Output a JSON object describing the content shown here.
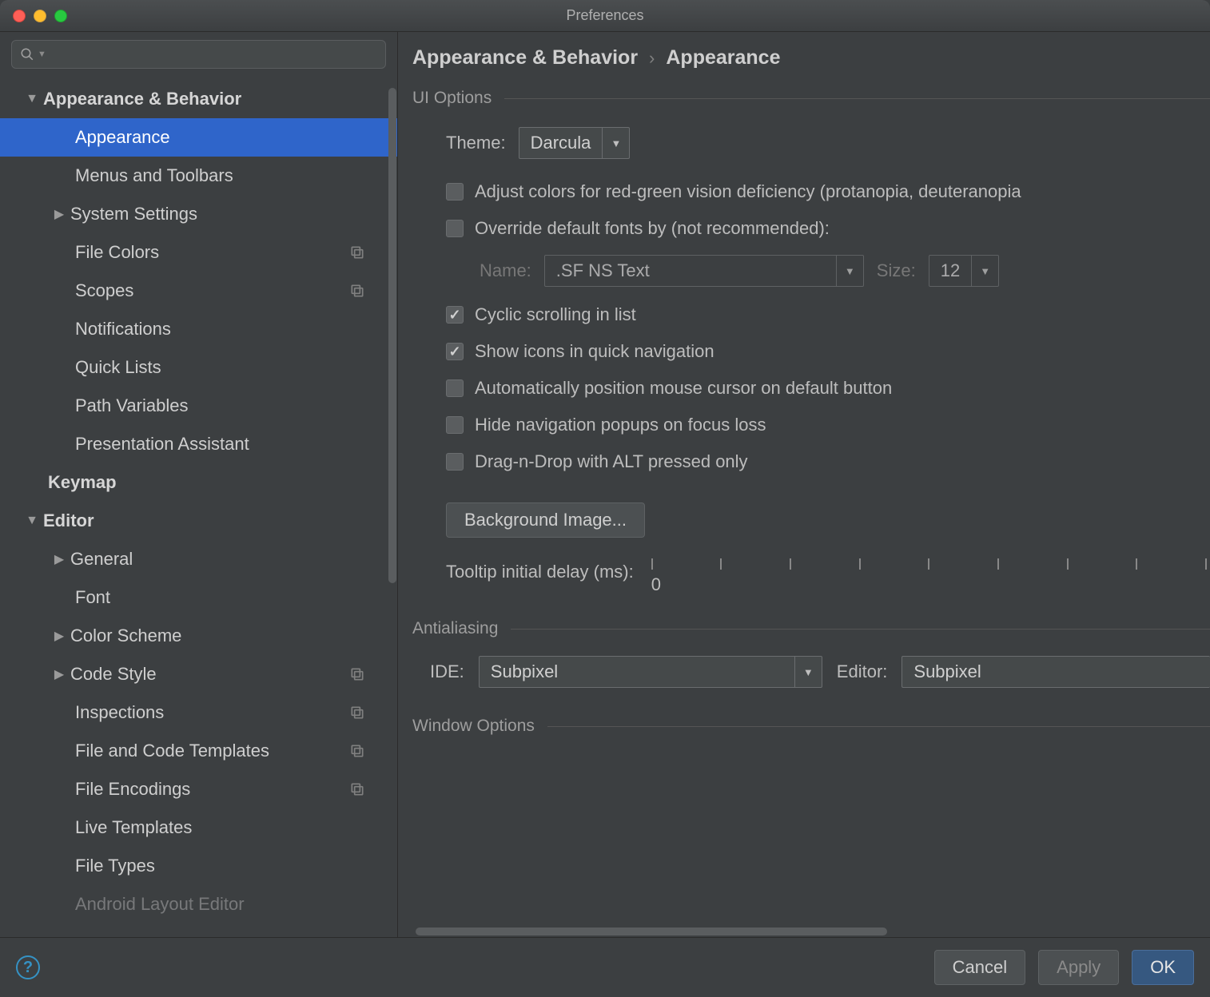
{
  "window": {
    "title": "Preferences"
  },
  "breadcrumb": {
    "root": "Appearance & Behavior",
    "leaf": "Appearance"
  },
  "sections": {
    "ui_options": "UI Options",
    "antialiasing": "Antialiasing",
    "window_options": "Window Options"
  },
  "sidebar": {
    "items": [
      {
        "label": "Appearance & Behavior",
        "level": 0,
        "expanded": true,
        "arrow": true
      },
      {
        "label": "Appearance",
        "level": 1,
        "selected": true
      },
      {
        "label": "Menus and Toolbars",
        "level": 1
      },
      {
        "label": "System Settings",
        "level": 1,
        "arrow": true,
        "expanded": false
      },
      {
        "label": "File Colors",
        "level": 1,
        "copyable": true
      },
      {
        "label": "Scopes",
        "level": 1,
        "copyable": true
      },
      {
        "label": "Notifications",
        "level": 1
      },
      {
        "label": "Quick Lists",
        "level": 1
      },
      {
        "label": "Path Variables",
        "level": 1
      },
      {
        "label": "Presentation Assistant",
        "level": 1
      },
      {
        "label": "Keymap",
        "level": 0,
        "arrow": false,
        "top": true
      },
      {
        "label": "Editor",
        "level": 0,
        "expanded": true,
        "arrow": true
      },
      {
        "label": "General",
        "level": 1,
        "arrow": true,
        "expanded": false
      },
      {
        "label": "Font",
        "level": 1
      },
      {
        "label": "Color Scheme",
        "level": 1,
        "arrow": true,
        "expanded": false
      },
      {
        "label": "Code Style",
        "level": 1,
        "arrow": true,
        "expanded": false,
        "copyable": true
      },
      {
        "label": "Inspections",
        "level": 1,
        "copyable": true
      },
      {
        "label": "File and Code Templates",
        "level": 1,
        "copyable": true
      },
      {
        "label": "File Encodings",
        "level": 1,
        "copyable": true
      },
      {
        "label": "Live Templates",
        "level": 1
      },
      {
        "label": "File Types",
        "level": 1
      },
      {
        "label": "Android Layout Editor",
        "level": 1,
        "partial": true
      }
    ]
  },
  "ui": {
    "theme_label": "Theme:",
    "theme_value": "Darcula",
    "cb_adjust_colors": "Adjust colors for red-green vision deficiency (protanopia, deuteranopia",
    "cb_override_fonts": "Override default fonts by (not recommended):",
    "font_name_label": "Name:",
    "font_name_value": ".SF NS Text",
    "font_size_label": "Size:",
    "font_size_value": "12",
    "cb_cyclic": "Cyclic scrolling in list",
    "cb_show_icons": "Show icons in quick navigation",
    "cb_auto_mouse": "Automatically position mouse cursor on default button",
    "cb_hide_nav": "Hide navigation popups on focus loss",
    "cb_dnd_alt": "Drag-n-Drop with ALT pressed only",
    "bg_image_btn": "Background Image...",
    "tooltip_label": "Tooltip initial delay (ms):",
    "tooltip_value": "0"
  },
  "aa": {
    "ide_label": "IDE:",
    "ide_value": "Subpixel",
    "editor_label": "Editor:",
    "editor_value": "Subpixel"
  },
  "footer": {
    "cancel": "Cancel",
    "apply": "Apply",
    "ok": "OK"
  }
}
